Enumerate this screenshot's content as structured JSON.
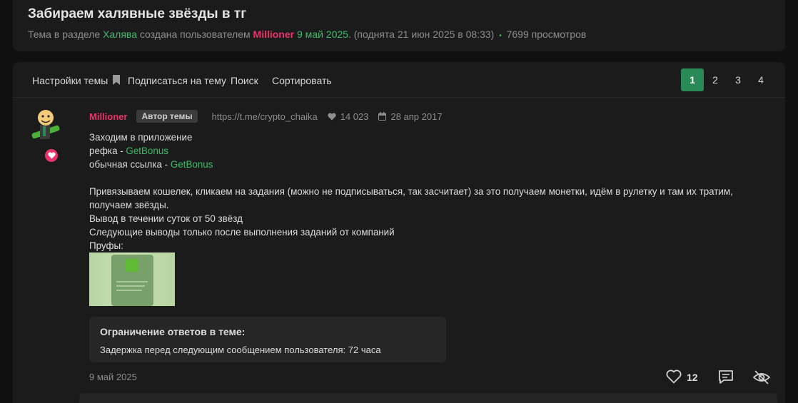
{
  "thread": {
    "title": "Забираем халявные звёзды в тг",
    "meta_prefix": "Тема в разделе",
    "section": "Халява",
    "meta_created": "создана пользователем",
    "author": "Millioner",
    "created_date": "9 май 2025",
    "bumped": ". (поднята 21 июн 2025 в 08:33)",
    "views": "7699 просмотров"
  },
  "toolbar": {
    "settings_label": "Настройки темы",
    "subscribe_label": "Подписаться на тему",
    "search_label": "Поиск",
    "sort_label": "Сортировать",
    "pages": [
      "1",
      "2",
      "3",
      "4"
    ],
    "active_page": "1"
  },
  "post": {
    "author": "Millioner",
    "author_badge": "Автор темы",
    "profile_link": "https://t.me/crypto_chaika",
    "likes_total": "14 023",
    "reg_date": "28 апр 2017",
    "line1": "Заходим в приложение",
    "line2_label": "рефка - ",
    "line2_link": "GetBonus",
    "line3_label": "обычная ссылка - ",
    "line3_link": "GetBonus",
    "para1": "Привязываем кошелек, кликаем на задания (можно не подписываться, так засчитает) за это получаем монетки, идём в рулетку и там их тратим, получаем звёзды.",
    "para2": "Вывод в течении суток от 50 звёзд",
    "para3": "Следующие выводы только после выполнения заданий от компаний",
    "proofs_label": "Пруфы:",
    "restriction_title": "Ограничение ответов в теме:",
    "restriction_text": "Задержка перед следующим сообщением пользователя: 72 часа",
    "date": "9 май 2025",
    "like_count": "12"
  },
  "colors": {
    "accent_green": "#3dbb6a",
    "author_pink": "#e8336d",
    "active_page": "#2a8a57",
    "card_bg": "#1b1b1b",
    "page_bg": "#101010"
  },
  "icons": [
    "bookmark-icon",
    "heart-icon",
    "calendar-icon",
    "like-icon",
    "reply-icon",
    "hide-icon"
  ]
}
